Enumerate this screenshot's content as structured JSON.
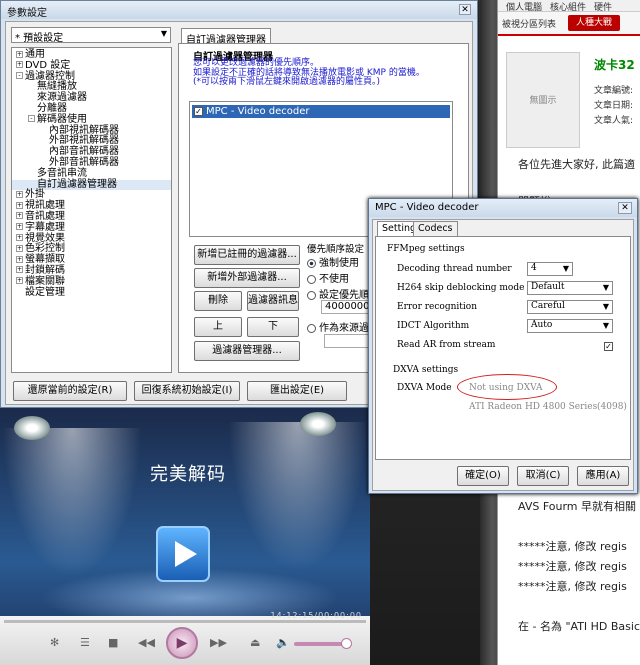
{
  "web": {
    "topnav": [
      "個人電腦",
      "核心組件",
      "硬件"
    ],
    "tab_link": "被視分區列表",
    "tab_hot": "人種大戰",
    "noimage": "無圖示",
    "title": "波卡32",
    "meta": [
      "文章編號:",
      "文章日期:",
      "文章人氣:"
    ],
    "greeting": "各位先進大家好, 此篇適",
    "heading": "問題說",
    "avs_line": "AVS Fourm 早就有相關",
    "notes": [
      "*****注意, 修改 regis",
      "*****注意, 修改 regis",
      "*****注意, 修改 regis"
    ],
    "footer": "在 - 名為 \"ATI HD Basic"
  },
  "settings": {
    "title": "參數設定",
    "preset": "* 預設設定",
    "tree": [
      {
        "label": "通用",
        "indent": 0,
        "toggle": "+"
      },
      {
        "label": "DVD 設定",
        "indent": 0,
        "toggle": "+"
      },
      {
        "label": "過濾器控制",
        "indent": 0,
        "toggle": "-"
      },
      {
        "label": "無縫播放",
        "indent": 1,
        "toggle": ""
      },
      {
        "label": "來源過濾器",
        "indent": 1,
        "toggle": ""
      },
      {
        "label": "分離器",
        "indent": 1,
        "toggle": ""
      },
      {
        "label": "解碼器使用",
        "indent": 1,
        "toggle": "-"
      },
      {
        "label": "內部視訊解碼器",
        "indent": 2,
        "toggle": ""
      },
      {
        "label": "外部視訊解碼器",
        "indent": 2,
        "toggle": ""
      },
      {
        "label": "內部音訊解碼器",
        "indent": 2,
        "toggle": ""
      },
      {
        "label": "外部音訊解碼器",
        "indent": 2,
        "toggle": ""
      },
      {
        "label": "多音訊串流",
        "indent": 1,
        "toggle": ""
      },
      {
        "label": "自訂過濾器管理器",
        "indent": 1,
        "toggle": "",
        "selected": true
      },
      {
        "label": "外掛",
        "indent": 0,
        "toggle": "+"
      },
      {
        "label": "視訊處理",
        "indent": 0,
        "toggle": "+"
      },
      {
        "label": "音訊處理",
        "indent": 0,
        "toggle": "+"
      },
      {
        "label": "字幕處理",
        "indent": 0,
        "toggle": "+"
      },
      {
        "label": "視覺效果",
        "indent": 0,
        "toggle": "+"
      },
      {
        "label": "色彩控制",
        "indent": 0,
        "toggle": "+"
      },
      {
        "label": "螢幕擷取",
        "indent": 0,
        "toggle": "+"
      },
      {
        "label": "封鎖解碼",
        "indent": 0,
        "toggle": "+"
      },
      {
        "label": "檔案關聯",
        "indent": 0,
        "toggle": "+"
      },
      {
        "label": "設定管理",
        "indent": 0,
        "toggle": ""
      }
    ],
    "tab": "自訂過濾器管理器",
    "panel_title": "自訂過濾器管理器",
    "panel_desc": [
      "您可以更改過濾器的優先順序。",
      "如果設定不正確的話將導致無法播放電影或 KMP 的當機。",
      "(*可以按兩下滑鼠左鍵來開啟過濾器的屬性頁。)"
    ],
    "filter": "MPC - Video decoder",
    "btn_add_registered": "新增已註冊的過濾器...",
    "btn_add_external": "新增外部過濾器...",
    "btn_delete": "刪除",
    "btn_info": "過濾器訊息",
    "btn_up": "上",
    "btn_down": "下",
    "btn_manager": "過濾器管理器...",
    "priority_label": "優先順序設定",
    "radio_force": "強制使用",
    "radio_notuse": "不使用",
    "radio_setprio": "設定優先順序",
    "prio_value": "40000001",
    "radio_source": "作為來源過濾",
    "btn_restore": "還原當前的設定(R)",
    "btn_reset": "回復系統初始設定(I)",
    "btn_export": "匯出設定(E)"
  },
  "player": {
    "title": "完美解码",
    "time": "14:12:15/00:00:00",
    "progress": 0.0,
    "volume": 0.85
  },
  "mpc": {
    "title": "MPC - Video decoder",
    "tabs": [
      "Settings",
      "Codecs"
    ],
    "ffmpeg_group": "FFMpeg settings",
    "decoding_threads_label": "Decoding thread number",
    "decoding_threads_value": "4",
    "h264_label": "H264 skip deblocking mode",
    "h264_value": "Default",
    "error_label": "Error recognition",
    "error_value": "Careful",
    "idct_label": "IDCT Algorithm",
    "idct_value": "Auto",
    "readar_label": "Read AR from stream",
    "readar_checked": true,
    "dxva_group": "DXVA settings",
    "dxva_mode_label": "DXVA Mode",
    "dxva_mode_value": "Not using DXVA",
    "gpu": "ATI Radeon HD 4800 Series",
    "gpu_id": "(4098)",
    "btn_ok": "確定(O)",
    "btn_cancel": "取消(C)",
    "btn_apply": "應用(A)",
    "highlight_color": "#d02020"
  }
}
